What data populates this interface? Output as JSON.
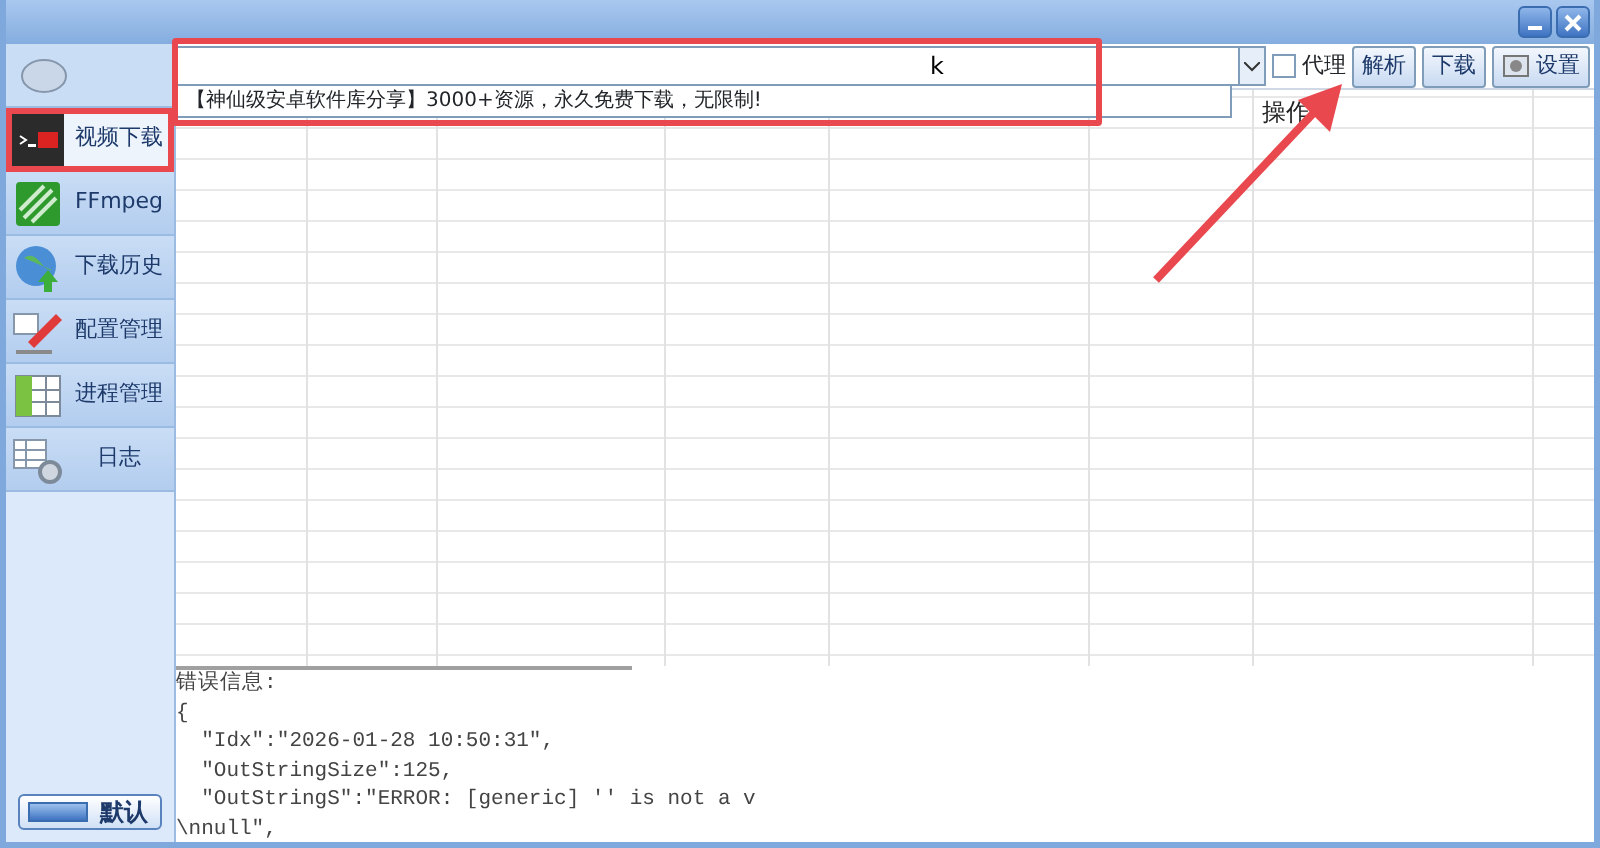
{
  "toolbar": {
    "url_value": "k",
    "dropdown_items": [
      "【神仙级安卓软件库分享】3000+资源，永久免费下载，无限制!"
    ],
    "proxy": {
      "label": "代理",
      "checked": false
    },
    "buttons": [
      {
        "kind": "parse",
        "label": "解析"
      },
      {
        "kind": "download",
        "label": "下载"
      },
      {
        "kind": "settings",
        "label": "设置"
      }
    ]
  },
  "sidebar": {
    "items": [
      {
        "kind": "video",
        "label": "视频下载",
        "selected": true
      },
      {
        "kind": "ffmpeg",
        "label": "FFmpeg",
        "selected": false
      },
      {
        "kind": "history",
        "label": "下载历史",
        "selected": false
      },
      {
        "kind": "config",
        "label": "配置管理",
        "selected": false
      },
      {
        "kind": "process",
        "label": "进程管理",
        "selected": false
      },
      {
        "kind": "log",
        "label": "日志",
        "selected": false
      }
    ],
    "default_button": "默认"
  },
  "table": {
    "columns": [
      {
        "label": "操作"
      }
    ]
  },
  "log": {
    "lines": [
      "错误信息:",
      "{",
      "  \"Idx\":\"2026-01-28 10:50:31\",",
      "  \"OutStringSize\":125,",
      "  \"OutStringS\":\"ERROR: [generic] '' is not a v",
      "\\nnull\","
    ]
  }
}
